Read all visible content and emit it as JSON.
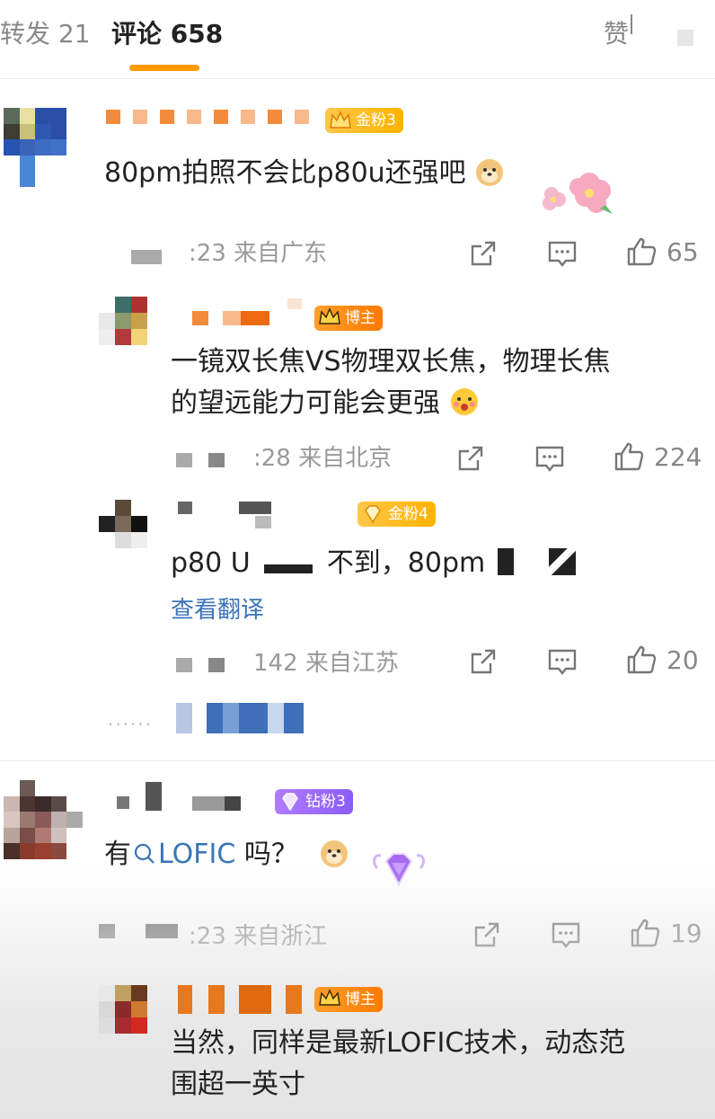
{
  "tabs": {
    "repost": "转发 21",
    "comments": "评论 658",
    "likes": "赞"
  },
  "colors": {
    "accent": "#ff9a00",
    "link": "#3a73b8",
    "meta_gray": "#999999"
  },
  "comments": [
    {
      "badge": "金粉3",
      "text": "80pm拍照不会比p80u还强吧",
      "meta": ":23 来自广东",
      "likes": "65",
      "replies": [
        {
          "badge": "博主",
          "text_line1": "一镜双长焦VS物理双长焦，物理长焦",
          "text_line2": "的望远能力可能会更强",
          "meta": ":28 来自北京",
          "likes": "224"
        },
        {
          "badge": "金粉4",
          "text_part1": "p80 U",
          "text_part2": "不到，80pm",
          "translate": "查看翻译",
          "meta": "142 来自江苏",
          "likes": "20"
        }
      ],
      "more": "......"
    },
    {
      "badge": "钻粉3",
      "text_prefix": "有",
      "link": "LOFIC",
      "text_suffix": " 吗？",
      "meta": ":23 来自浙江",
      "likes": "19",
      "replies": [
        {
          "badge": "博主",
          "text_line1": "当然，同样是最新LOFIC技术，动态范",
          "text_line2": "围超一英寸"
        }
      ]
    }
  ],
  "icons": [
    "share-icon",
    "comment-icon",
    "thumb-up-icon",
    "doge-emoji",
    "sakura-sticker",
    "crown-icon",
    "diamond-icon"
  ]
}
